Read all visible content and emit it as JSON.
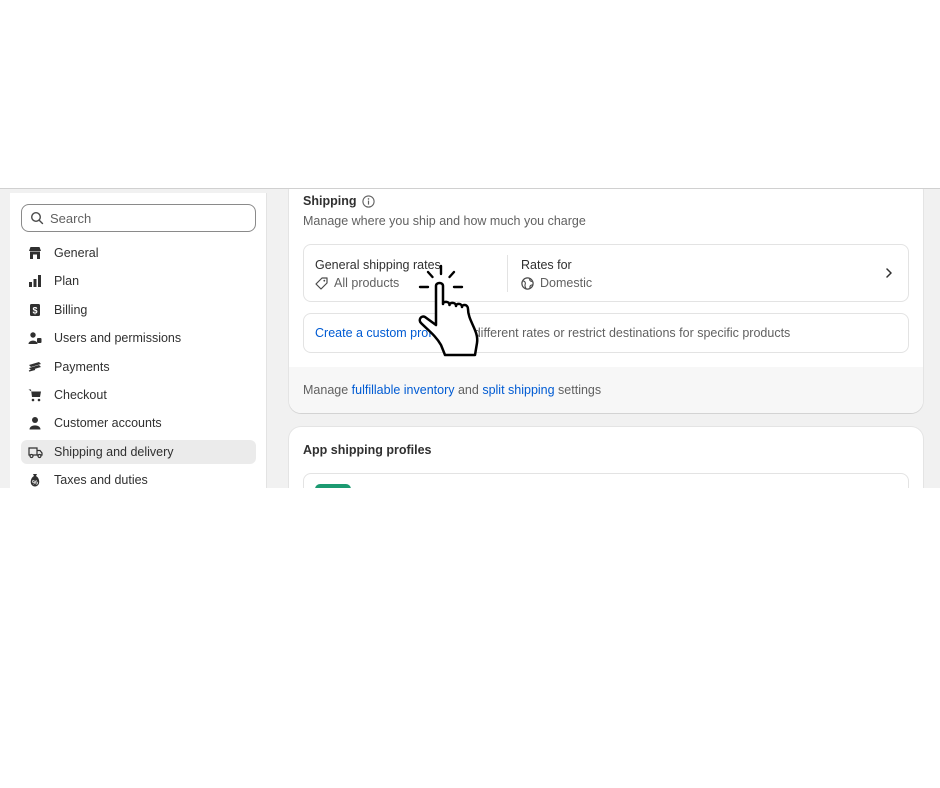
{
  "search": {
    "placeholder": "Search"
  },
  "sidebar": {
    "items": [
      {
        "label": "General",
        "icon": "store-icon"
      },
      {
        "label": "Plan",
        "icon": "plan-icon"
      },
      {
        "label": "Billing",
        "icon": "billing-icon"
      },
      {
        "label": "Users and permissions",
        "icon": "users-icon"
      },
      {
        "label": "Payments",
        "icon": "payments-icon"
      },
      {
        "label": "Checkout",
        "icon": "cart-icon"
      },
      {
        "label": "Customer accounts",
        "icon": "person-icon"
      },
      {
        "label": "Shipping and delivery",
        "icon": "truck-icon",
        "active": true
      },
      {
        "label": "Taxes and duties",
        "icon": "tax-icon"
      }
    ]
  },
  "shipping": {
    "title": "Shipping",
    "subtitle": "Manage where you ship and how much you charge",
    "rates": {
      "label": "General shipping rates",
      "products": "All products",
      "rates_for_label": "Rates for",
      "region": "Domestic"
    },
    "custom": {
      "link": "Create a custom prof",
      "text": "different rates or restrict destinations for specific products"
    },
    "footer": {
      "prefix": "Manage ",
      "link1": "fulfillable inventory",
      "middle": " and ",
      "link2": "split shipping",
      "suffix": " settings"
    }
  },
  "app_profiles": {
    "title": "App shipping profiles"
  },
  "colors": {
    "link": "#005bd3",
    "active_bg": "#ebebeb",
    "app_logo": "#1c9a71"
  }
}
